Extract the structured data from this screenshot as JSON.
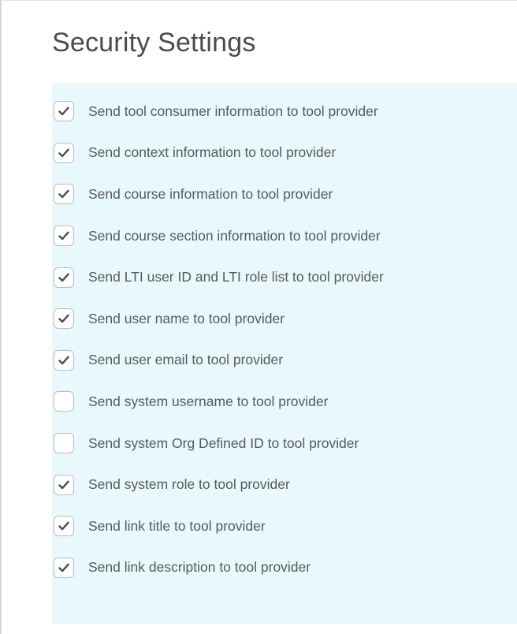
{
  "page": {
    "title": "Security Settings"
  },
  "colors": {
    "panel_background": "#e9f8fd",
    "text": "#565a5c",
    "title": "#494c4e",
    "checkbox_border": "#b7bdc1",
    "checkmark": "#494c4e"
  },
  "security_options": [
    {
      "label": "Send tool consumer information to tool provider",
      "checked": true
    },
    {
      "label": "Send context information to tool provider",
      "checked": true
    },
    {
      "label": "Send course information to tool provider",
      "checked": true
    },
    {
      "label": "Send course section information to tool provider",
      "checked": true
    },
    {
      "label": "Send LTI user ID and LTI role list to tool provider",
      "checked": true
    },
    {
      "label": "Send user name to tool provider",
      "checked": true
    },
    {
      "label": "Send user email to tool provider",
      "checked": true
    },
    {
      "label": "Send system username to tool provider",
      "checked": false
    },
    {
      "label": "Send system Org Defined ID to tool provider",
      "checked": false
    },
    {
      "label": "Send system role to tool provider",
      "checked": true
    },
    {
      "label": "Send link title to tool provider",
      "checked": true
    },
    {
      "label": "Send link description to tool provider",
      "checked": true
    }
  ]
}
